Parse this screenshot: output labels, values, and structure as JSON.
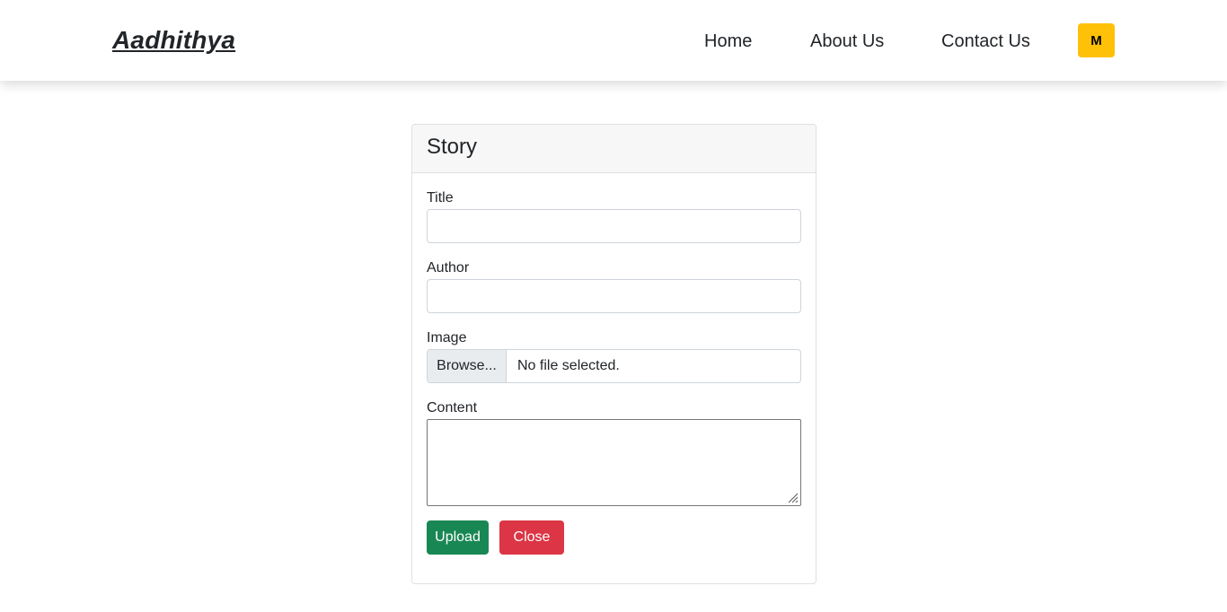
{
  "navbar": {
    "brand": "Aadhithya",
    "links": [
      "Home",
      "About Us",
      "Contact Us"
    ],
    "avatar_label": "M",
    "avatar_color": "#ffc107"
  },
  "form": {
    "header": "Story",
    "title_label": "Title",
    "title_value": "",
    "author_label": "Author",
    "author_value": "",
    "image_label": "Image",
    "browse_label": "Browse...",
    "file_status": "No file selected.",
    "content_label": "Content",
    "content_value": "",
    "upload_label": "Upload",
    "close_label": "Close",
    "upload_color": "#198754",
    "close_color": "#dc3545"
  }
}
